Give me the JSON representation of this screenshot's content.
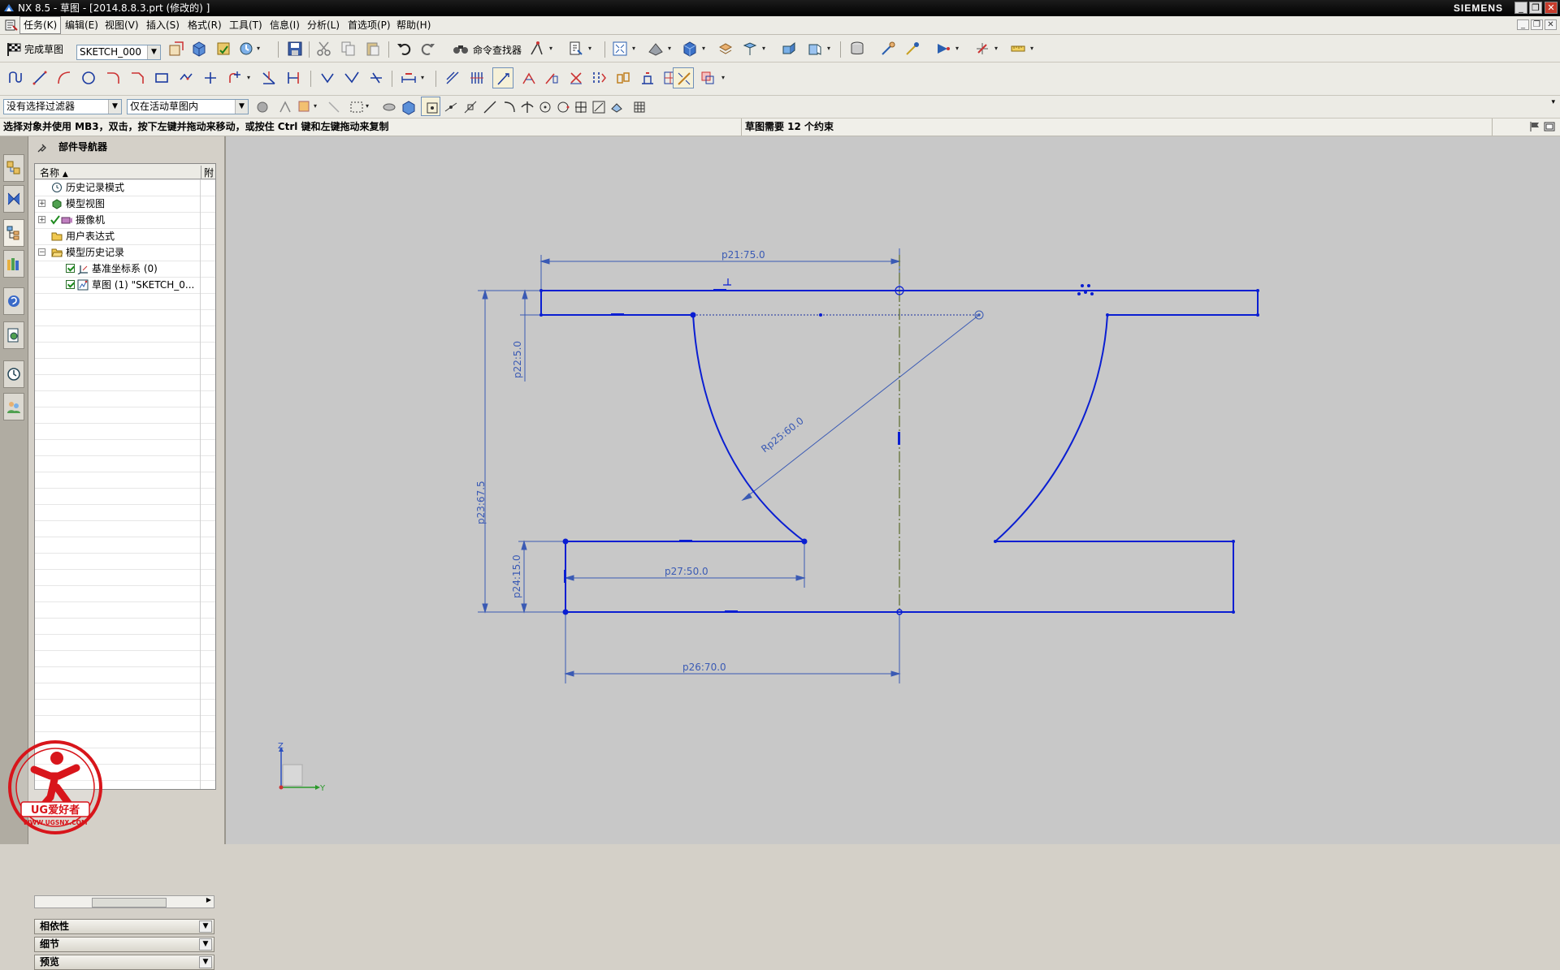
{
  "titlebar": {
    "title": "NX 8.5 - 草图 - [2014.8.8.3.prt (修改的) ]",
    "brand": "SIEMENS",
    "buttons": [
      "_",
      "❐",
      "✕"
    ]
  },
  "menubar": {
    "items": [
      "任务(K)",
      "编辑(E)",
      "视图(V)",
      "插入(S)",
      "格式(R)",
      "工具(T)",
      "信息(I)",
      "分析(L)",
      "首选项(P)",
      "帮助(H)"
    ]
  },
  "toolbar1": {
    "finish_sketch_label": "完成草图",
    "sketch_name": "SKETCH_000",
    "command_finder_label": "命令查找器"
  },
  "selection_bar": {
    "filter_value": "没有选择过滤器",
    "scope_value": "仅在活动草图内"
  },
  "cue": {
    "prompt": "选择对象并使用 MB3，双击，按下左键并拖动来移动，或按住 Ctrl 键和左键拖动来复制",
    "status": "草图需要 12 个约束"
  },
  "navigator": {
    "title": "部件导航器",
    "col_name": "名称",
    "col_attach": "附",
    "tree": [
      {
        "label": "历史记录模式"
      },
      {
        "label": "模型视图"
      },
      {
        "label": "摄像机"
      },
      {
        "label": "用户表达式"
      },
      {
        "label": "模型历史记录"
      },
      {
        "label": "基准坐标系 (0)"
      },
      {
        "label": "草图 (1) \"SKETCH_0..."
      }
    ],
    "panels": [
      "相依性",
      "细节",
      "预览"
    ]
  },
  "sketch": {
    "dimensions": {
      "d1": "p21:75.0",
      "d2": "p22:5.0",
      "d3": "Rp25:60.0",
      "d4": "p23:67.5",
      "d5": "p24:15.0",
      "d6": "p27:50.0",
      "d7": "p26:70.0"
    },
    "triad": {
      "z": "Z",
      "y": "Y"
    }
  },
  "watermark": {
    "main": "UG爱好者",
    "url": "WWW.UGSNX.COM"
  },
  "colors": {
    "sketch_curve": "#0a1ed2",
    "dimension": "#3a5ab4",
    "background": "#c8c8c8"
  }
}
